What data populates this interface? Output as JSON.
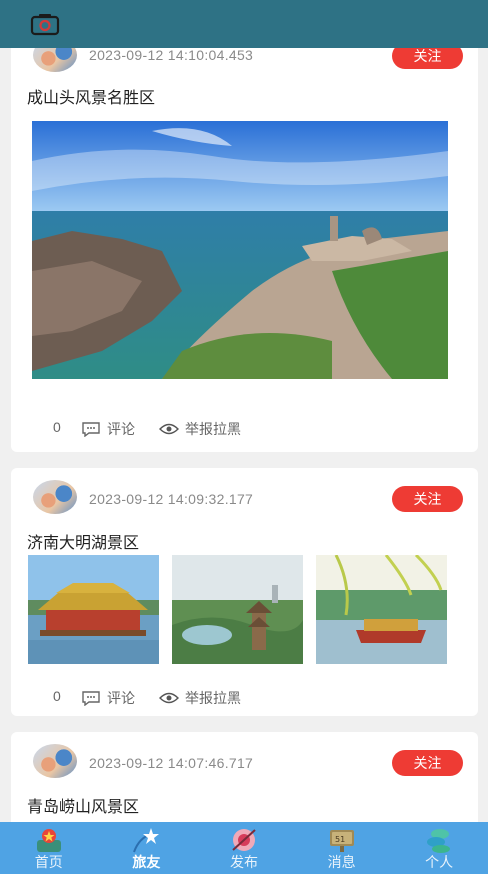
{
  "header": {
    "camera_icon": "camera-icon"
  },
  "posts": [
    {
      "time": "2023-09-12 14:10:04.453",
      "follow_label": "关注",
      "title": "成山头风景名胜区",
      "count": "0",
      "comment_label": "评论",
      "report_label": "举报拉黑"
    },
    {
      "time": "2023-09-12 14:09:32.177",
      "follow_label": "关注",
      "title": "济南大明湖景区",
      "count": "0",
      "comment_label": "评论",
      "report_label": "举报拉黑"
    },
    {
      "time": "2023-09-12 14:07:46.717",
      "follow_label": "关注",
      "title": "青岛崂山风景区"
    }
  ],
  "tabbar": {
    "items": [
      {
        "label": "首页",
        "icon": "home-icon"
      },
      {
        "label": "旅友",
        "icon": "friends-icon"
      },
      {
        "label": "发布",
        "icon": "publish-icon"
      },
      {
        "label": "消息",
        "icon": "message-icon"
      },
      {
        "label": "个人",
        "icon": "profile-icon"
      }
    ],
    "active": "旅友"
  },
  "colors": {
    "header": "#2e7285",
    "follow": "#ee3b34",
    "tabbar": "#4fa3e4"
  }
}
